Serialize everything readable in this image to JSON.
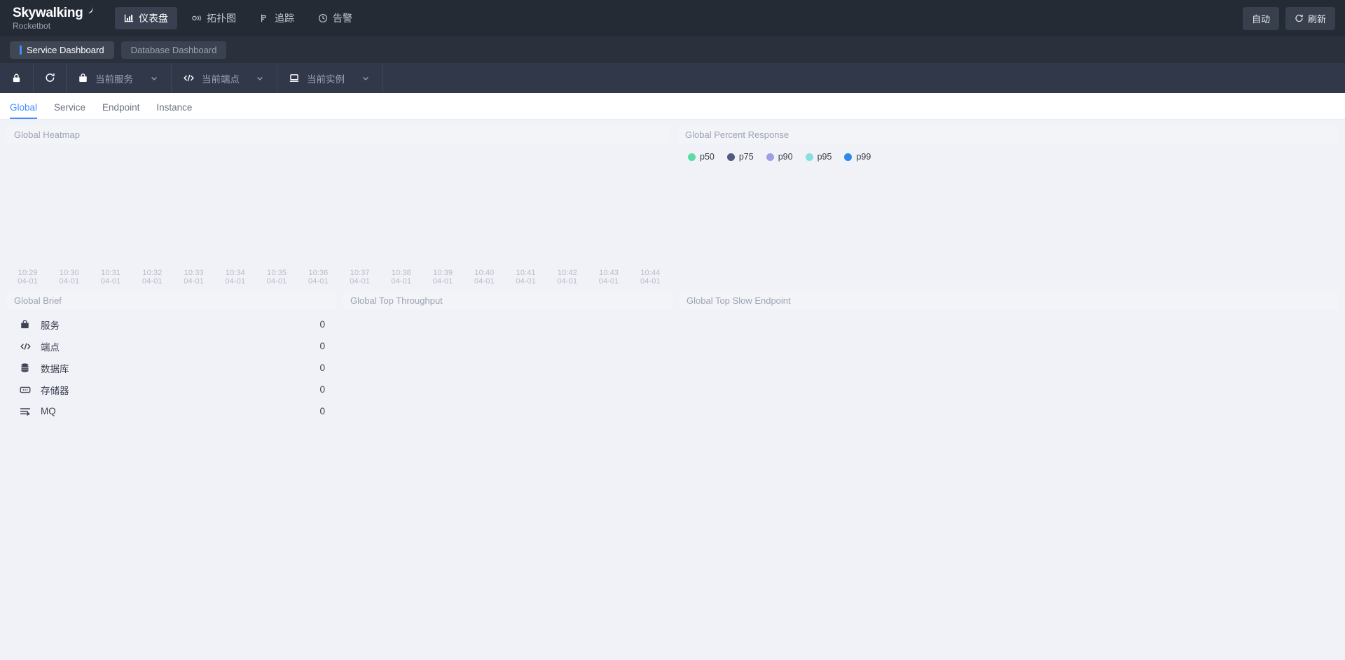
{
  "brand": {
    "name": "Skywalking",
    "sub": "Rocketbot"
  },
  "nav": [
    {
      "label": "仪表盘",
      "icon": "dashboard-icon",
      "active": true
    },
    {
      "label": "拓扑图",
      "icon": "topology-icon",
      "active": false
    },
    {
      "label": "追踪",
      "icon": "trace-icon",
      "active": false
    },
    {
      "label": "告警",
      "icon": "alarm-icon",
      "active": false
    }
  ],
  "header_actions": [
    {
      "label": "自动",
      "icon": "none"
    },
    {
      "label": "刷新",
      "icon": "refresh-icon"
    }
  ],
  "dashboard_tabs": [
    {
      "label": "Service Dashboard",
      "active": true
    },
    {
      "label": "Database Dashboard",
      "active": false
    }
  ],
  "toolbar": {
    "lock_icon": "lock-icon",
    "reload_icon": "reload-icon",
    "selectors": [
      {
        "icon": "service-icon",
        "value": "当前服务"
      },
      {
        "icon": "endpoint-icon",
        "value": "当前端点"
      },
      {
        "icon": "instance-icon",
        "value": "当前实例"
      }
    ]
  },
  "sub_tabs": [
    {
      "label": "Global",
      "active": true
    },
    {
      "label": "Service",
      "active": false
    },
    {
      "label": "Endpoint",
      "active": false
    },
    {
      "label": "Instance",
      "active": false
    }
  ],
  "panels": {
    "heatmap": {
      "title": "Global Heatmap"
    },
    "percent_response": {
      "title": "Global Percent Response"
    },
    "brief": {
      "title": "Global Brief"
    },
    "top_throughput": {
      "title": "Global Top Throughput"
    },
    "top_slow_endpoint": {
      "title": "Global Top Slow Endpoint"
    }
  },
  "brief_rows": [
    {
      "icon": "service-icon",
      "label": "服务",
      "value": "0"
    },
    {
      "icon": "endpoint-icon",
      "label": "端点",
      "value": "0"
    },
    {
      "icon": "database-icon",
      "label": "数据库",
      "value": "0"
    },
    {
      "icon": "cache-icon",
      "label": "存储器",
      "value": "0"
    },
    {
      "icon": "mq-icon",
      "label": "MQ",
      "value": "0"
    }
  ],
  "chart_data": [
    {
      "type": "heatmap",
      "title": "Global Heatmap",
      "xlabel": "",
      "ylabel": "",
      "categories": [
        "10:29 04-01",
        "10:30 04-01",
        "10:31 04-01",
        "10:32 04-01",
        "10:33 04-01",
        "10:34 04-01",
        "10:35 04-01",
        "10:36 04-01",
        "10:37 04-01",
        "10:38 04-01",
        "10:39 04-01",
        "10:40 04-01",
        "10:41 04-01",
        "10:42 04-01",
        "10:43 04-01",
        "10:44 04-01"
      ],
      "values": [],
      "grid": false,
      "note": "no data rendered"
    },
    {
      "type": "line",
      "title": "Global Percent Response",
      "xlabel": "",
      "ylabel": "",
      "categories": [],
      "legend_position": "top-left",
      "series": [
        {
          "name": "p50",
          "color": "#5ddba4",
          "values": []
        },
        {
          "name": "p75",
          "color": "#545a7e",
          "values": []
        },
        {
          "name": "p90",
          "color": "#9f9ce8",
          "values": []
        },
        {
          "name": "p95",
          "color": "#87e0e0",
          "values": []
        },
        {
          "name": "p99",
          "color": "#2b8ae8",
          "values": []
        }
      ],
      "grid": false,
      "note": "no data rendered"
    }
  ],
  "ticks": [
    {
      "t": "10:29",
      "d": "04-01"
    },
    {
      "t": "10:30",
      "d": "04-01"
    },
    {
      "t": "10:31",
      "d": "04-01"
    },
    {
      "t": "10:32",
      "d": "04-01"
    },
    {
      "t": "10:33",
      "d": "04-01"
    },
    {
      "t": "10:34",
      "d": "04-01"
    },
    {
      "t": "10:35",
      "d": "04-01"
    },
    {
      "t": "10:36",
      "d": "04-01"
    },
    {
      "t": "10:37",
      "d": "04-01"
    },
    {
      "t": "10:38",
      "d": "04-01"
    },
    {
      "t": "10:39",
      "d": "04-01"
    },
    {
      "t": "10:40",
      "d": "04-01"
    },
    {
      "t": "10:41",
      "d": "04-01"
    },
    {
      "t": "10:42",
      "d": "04-01"
    },
    {
      "t": "10:43",
      "d": "04-01"
    },
    {
      "t": "10:44",
      "d": "04-01"
    }
  ],
  "colors": {
    "header_bg": "#252b35",
    "tabstrip_bg": "#2b313c",
    "toolbar_bg": "#31384a",
    "accent": "#448dfe",
    "page_bg": "#f1f2f7",
    "panel_head_bg": "#f3f4f8"
  }
}
